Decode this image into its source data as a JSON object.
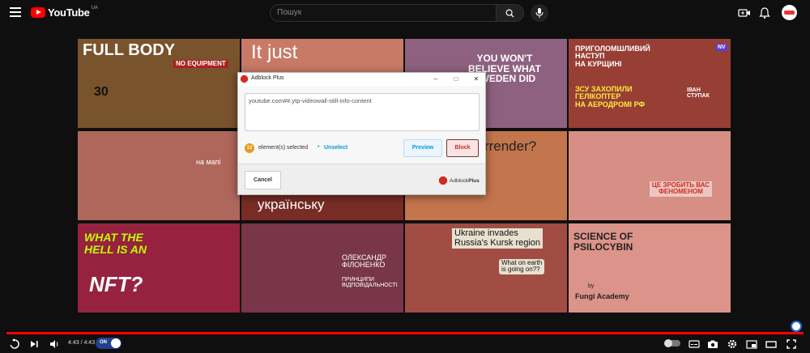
{
  "header": {
    "brand": "YouTube",
    "country_code": "UA",
    "search_placeholder": "Пошук"
  },
  "thumbnails": [
    {
      "lines": [
        "FULL BODY",
        "NO EQUIPMENT",
        "30"
      ],
      "bg": "#4a7a3a"
    },
    {
      "lines": [
        "It just"
      ],
      "bg": "#c8b89a"
    },
    {
      "lines": [
        "YOU WON'T",
        "BELIEVE WHAT",
        "SWEDEN DID"
      ],
      "bg": "#6a90c0"
    },
    {
      "lines": [
        "ПРИГОЛОМШЛИВИЙ",
        "НАСТУП",
        "НА КУРЩИНІ",
        "ЗСУ ЗАХОПИЛИ",
        "ГЕЛІКОПТЕР",
        "НА АЕРОДРОМІ РФ",
        "ІВАН",
        "СТУПАК",
        "NV"
      ],
      "bg": "#7a5a4a"
    },
    {
      "lines": [
        "на мапі"
      ],
      "bg": "#a09a88"
    },
    {
      "lines": [
        "українську"
      ],
      "bg": "#4a3a30"
    },
    {
      "lines": [
        "surrender?"
      ],
      "bg": "#c0b070"
    },
    {
      "lines": [
        "ЦЕ ЗРОБИТЬ ВАС",
        "ФЕНОМЕНОМ"
      ],
      "bg": "#e0d8c8"
    },
    {
      "lines": [
        "WHAT THE",
        "HELL IS AN",
        "NFT?"
      ],
      "bg": "#7a2a5a"
    },
    {
      "lines": [
        "ОЛЕКСАНДР",
        "ФІЛОНЕНКО",
        "ПРИНЦИПИ",
        "ВІДПОВІДАЛЬНОСТІ"
      ],
      "bg": "#4a4a6a"
    },
    {
      "lines": [
        "Ukraine invades",
        "Russia's Kursk region",
        "What on earth",
        "is going on??"
      ],
      "bg": "#8a7060"
    },
    {
      "lines": [
        "SCIENCE OF",
        "PSILOCYBIN",
        "by",
        "Fungi Academy"
      ],
      "bg": "#e8e0d0"
    }
  ],
  "dialog": {
    "title": "Adblock Plus",
    "filter_text": "youtube.com##.ytp-videowall-still-info-content",
    "selected_count": "12",
    "selected_label": "element(s) selected",
    "unselect_label": "Unselect",
    "preview_label": "Preview",
    "block_label": "Block",
    "cancel_label": "Cancel",
    "brand_regular": "Adblock",
    "brand_bold": "Plus",
    "brand_color": "#d32a1f",
    "accent_color": "#0797e1"
  },
  "player": {
    "time": "4:43 / 4:43",
    "toggle_label": "ON",
    "progress_fraction": 1.0
  }
}
